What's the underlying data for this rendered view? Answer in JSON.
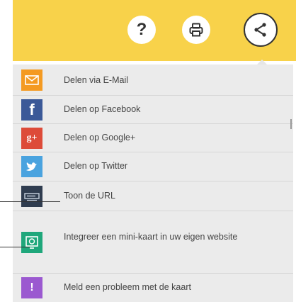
{
  "toolbar": {
    "help_glyph": "?",
    "buttons": [
      "help-button",
      "print-button",
      "share-button"
    ]
  },
  "share_menu": {
    "items": [
      {
        "label": "Delen via E-Mail",
        "icon": "email-icon",
        "color": "#f49a22"
      },
      {
        "label": "Delen op Facebook",
        "icon": "facebook-icon",
        "color": "#3b5998",
        "glyph": "f"
      },
      {
        "label": "Delen op Google+",
        "icon": "google-plus-icon",
        "color": "#dd4b39",
        "glyph": "g+"
      },
      {
        "label": "Delen op Twitter",
        "icon": "twitter-icon",
        "color": "#4aa3df"
      },
      {
        "label": "Toon de URL",
        "icon": "url-icon",
        "color": "#2f3c4f"
      },
      {
        "label": "Integreer een mini-kaart in uw eigen website",
        "icon": "embed-map-icon",
        "color": "#1fa77b"
      },
      {
        "label": "Meld een probleem met de kaart",
        "icon": "report-problem-icon",
        "color": "#9b59d0",
        "glyph": "!"
      }
    ]
  },
  "colors": {
    "topbar": "#f8d24a",
    "menu_background": "#ebebeb"
  }
}
